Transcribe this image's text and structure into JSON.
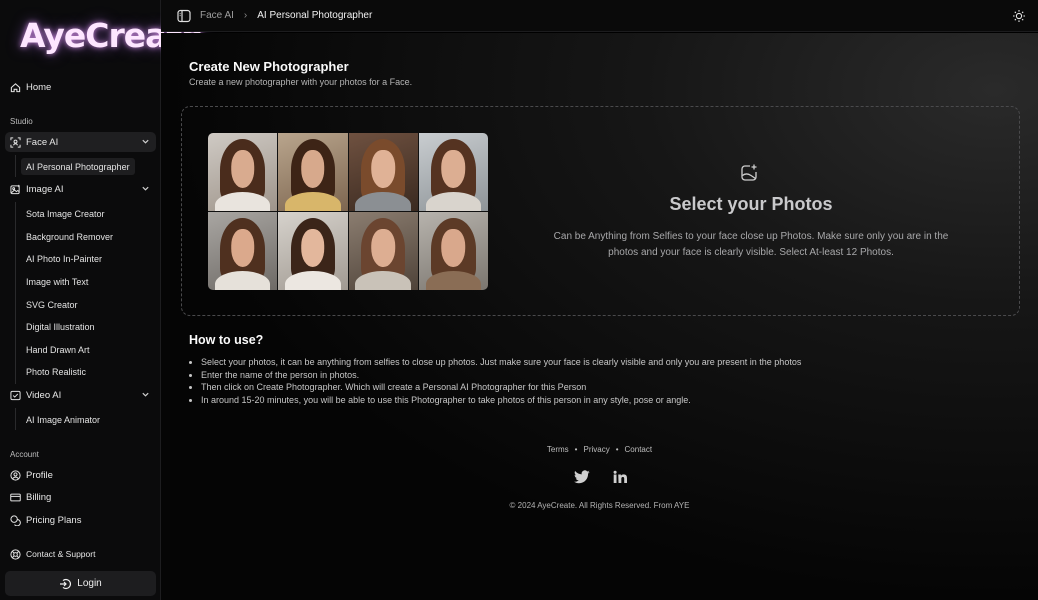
{
  "app": {
    "logo_text": "AyeCreate"
  },
  "sidebar": {
    "home": "Home",
    "studio_label": "Studio",
    "face_ai": {
      "label": "Face AI",
      "items": [
        "AI Personal Photographer"
      ]
    },
    "image_ai": {
      "label": "Image AI",
      "items": [
        "Sota Image Creator",
        "Background Remover",
        "AI Photo In-Painter",
        "Image with Text",
        "SVG Creator",
        "Digital Illustration",
        "Hand Drawn Art",
        "Photo Realistic"
      ]
    },
    "video_ai": {
      "label": "Video AI",
      "items": [
        "AI Image Animator"
      ]
    },
    "account_label": "Account",
    "profile": "Profile",
    "billing": "Billing",
    "pricing": "Pricing Plans",
    "contact": "Contact & Support",
    "login": "Login"
  },
  "topbar": {
    "crumb_parent": "Face AI",
    "crumb_current": "AI Personal Photographer"
  },
  "main": {
    "title": "Create New Photographer",
    "subtitle": "Create a new photographer with your photos for a Face.",
    "dropzone": {
      "title": "Select your Photos",
      "description": "Can be Anything from Selfies to your face close up Photos. Make sure only you are in the photos and your face is clearly visible. Select At-least 12 Photos."
    },
    "howto": {
      "title": "How to use?",
      "steps": [
        "Select your photos, it can be anything from selfies to close up photos. Just make sure your face is clearly visible and only you are present in the photos",
        "Enter the name of the person in photos.",
        "Then click on Create Photographer. Which will create a Personal AI Photographer for this Person",
        "In around 15-20 minutes, you will be able to use this Photographer to take photos of this person in any style, pose or angle."
      ]
    }
  },
  "footer": {
    "links": [
      "Terms",
      "Privacy",
      "Contact"
    ],
    "social": [
      "twitter-icon",
      "linkedin-icon"
    ],
    "copyright": "© 2024 AyeCreate. All Rights Reserved. From AYE"
  },
  "colors": {
    "background": "#000000",
    "sidebar": "#0b0b0c",
    "active_item": "#1f1f21",
    "logo_glow": "#e9a0ff"
  }
}
